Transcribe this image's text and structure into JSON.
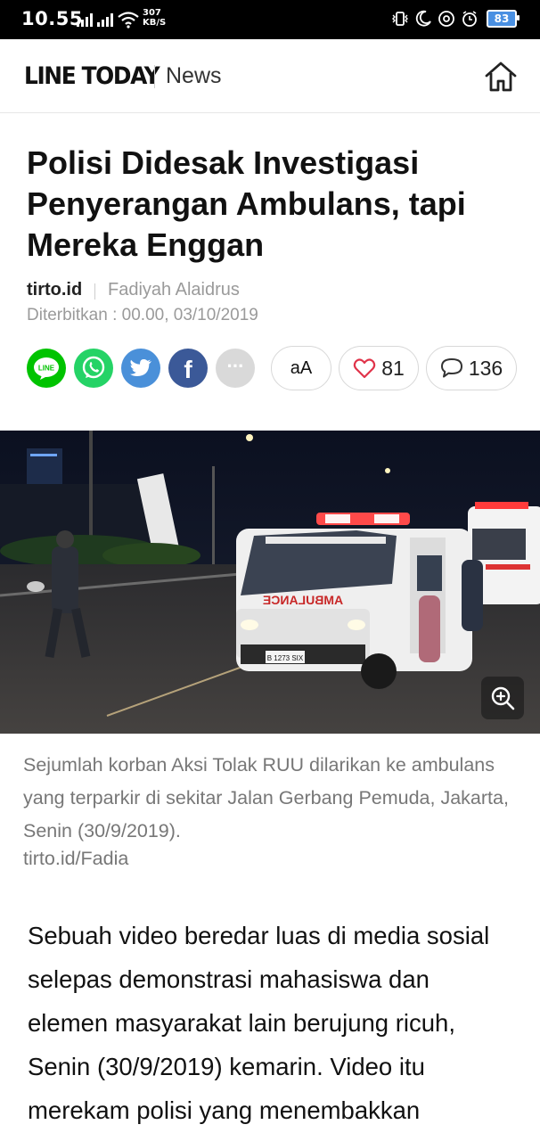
{
  "status_bar": {
    "time": "10.55",
    "net_speed_value": "307",
    "net_speed_unit": "KB/S",
    "battery": "83"
  },
  "header": {
    "logo": "LINE TODAY",
    "section": "News",
    "home_icon": "home-icon"
  },
  "article": {
    "title": "Polisi Didesak Investigasi Penyerangan Ambulans, tapi Mereka Enggan",
    "source": "tirto.id",
    "author": "Fadiyah Alaidrus",
    "published": "Diterbitkan : 00.00, 03/10/2019"
  },
  "share": {
    "icons": [
      "line-icon",
      "whatsapp-icon",
      "twitter-icon",
      "facebook-icon",
      "more-icon"
    ],
    "line_label": "LINE",
    "facebook_label": "f",
    "more_label": "···",
    "colors": {
      "line": "#00c300",
      "whatsapp": "#25d366",
      "twitter": "#4a90d9",
      "facebook": "#3b5998",
      "more": "#d9d9d9"
    }
  },
  "actions": {
    "font_size_label": "aA",
    "likes": "81",
    "comments": "136"
  },
  "photo": {
    "plate_text": "B 1273 SIX",
    "ambulance_text": "AMBULANCE",
    "zoom_icon": "zoom-in-icon"
  },
  "caption": {
    "text": "Sejumlah korban Aksi Tolak RUU dilarikan ke ambulans yang terparkir di sekitar Jalan Gerbang Pemuda, Jakarta, Senin (30/9/2019).",
    "credit": "tirto.id/Fadia"
  },
  "body": {
    "paragraph": "Sebuah video beredar luas di media sosial selepas demonstrasi mahasiswa dan elemen masyarakat lain berujung ricuh, Senin (30/9/2019) kemarin. Video itu merekam polisi yang menembakkan"
  }
}
